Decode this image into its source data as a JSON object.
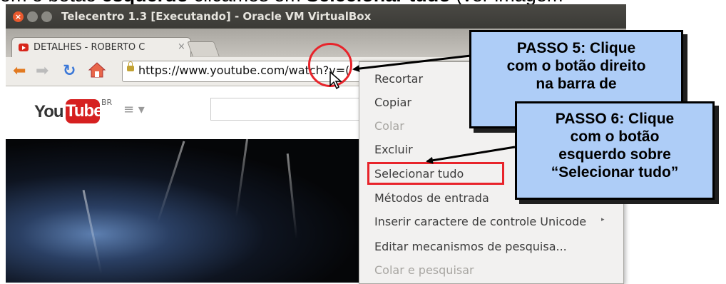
{
  "doc": {
    "prefix": "om o botão ",
    "bold1": "esquerdo",
    "mid": " clicamos em ",
    "bold2": "Selecionar tudo",
    "suffix": " (ver imagem"
  },
  "window": {
    "title": "Telecentro 1.3 [Executando] - Oracle VM VirtualBox"
  },
  "browser": {
    "tab_label": "DETALHES - ROBERTO C",
    "tab_close": "×",
    "url": "https://www.youtube.com/watch?v=("
  },
  "youtube": {
    "logo_you": "You",
    "logo_tube": "Tube",
    "region": "BR",
    "menu_glyph": "≡ ▾"
  },
  "context_menu": {
    "items": [
      {
        "label": "Recortar",
        "enabled": true
      },
      {
        "label": "Copiar",
        "enabled": true
      },
      {
        "label": "Colar",
        "enabled": false
      },
      {
        "label": "Excluir",
        "enabled": true
      },
      {
        "label": "Selecionar tudo",
        "enabled": true
      },
      {
        "label": "Métodos de entrada",
        "enabled": true
      },
      {
        "label": "Inserir caractere de controle Unicode",
        "enabled": true
      },
      {
        "label": "Editar mecanismos de pesquisa...",
        "enabled": true
      },
      {
        "label": "Colar e pesquisar",
        "enabled": false
      }
    ],
    "submenu_arrow": "▸"
  },
  "callouts": {
    "step5": [
      "PASSO 5: Clique",
      "com o botão direito",
      "na barra de"
    ],
    "step6": [
      "PASSO 6: Clique",
      "com o botão",
      "esquerdo sobre",
      "“Selecionar tudo”"
    ]
  },
  "colors": {
    "callout_fill": "#aecdf7",
    "highlight_red": "#e8242b",
    "ubuntu_close": "#e9592e"
  }
}
